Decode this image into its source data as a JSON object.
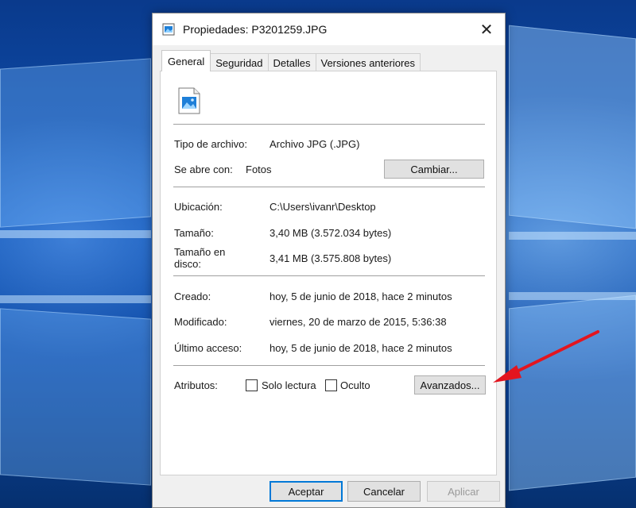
{
  "window": {
    "title": "Propiedades: P3201259.JPG",
    "close_glyph": "✕"
  },
  "tabs": [
    {
      "label": "General",
      "active": true
    },
    {
      "label": "Seguridad",
      "active": false
    },
    {
      "label": "Detalles",
      "active": false
    },
    {
      "label": "Versiones anteriores",
      "active": false
    }
  ],
  "general": {
    "file_type_label": "Tipo de archivo:",
    "file_type_value": "Archivo JPG (.JPG)",
    "opens_with_label": "Se abre con:",
    "opens_with_value": "Fotos",
    "change_button": "Cambiar...",
    "location_label": "Ubicación:",
    "location_value": "C:\\Users\\ivanr\\Desktop",
    "size_label": "Tamaño:",
    "size_value": "3,40 MB (3.572.034 bytes)",
    "size_on_disk_label": "Tamaño en disco:",
    "size_on_disk_value": "3,41 MB (3.575.808 bytes)",
    "created_label": "Creado:",
    "created_value": "hoy, 5 de junio de 2018, hace 2 minutos",
    "modified_label": "Modificado:",
    "modified_value": "viernes, 20 de marzo de 2015, 5:36:38",
    "accessed_label": "Último acceso:",
    "accessed_value": "hoy, 5 de junio de 2018, hace 2 minutos",
    "attributes_label": "Atributos:",
    "readonly_label": "Solo lectura",
    "readonly_checked": false,
    "hidden_label": "Oculto",
    "hidden_checked": false,
    "advanced_button": "Avanzados..."
  },
  "footer": {
    "accept": "Aceptar",
    "cancel": "Cancelar",
    "apply": "Aplicar"
  },
  "icons": {
    "title": "image-file-icon",
    "file": "image-file-icon",
    "annotation": "red-arrow-icon"
  },
  "colors": {
    "accent": "#0078d7",
    "arrow": "#e3151f"
  }
}
